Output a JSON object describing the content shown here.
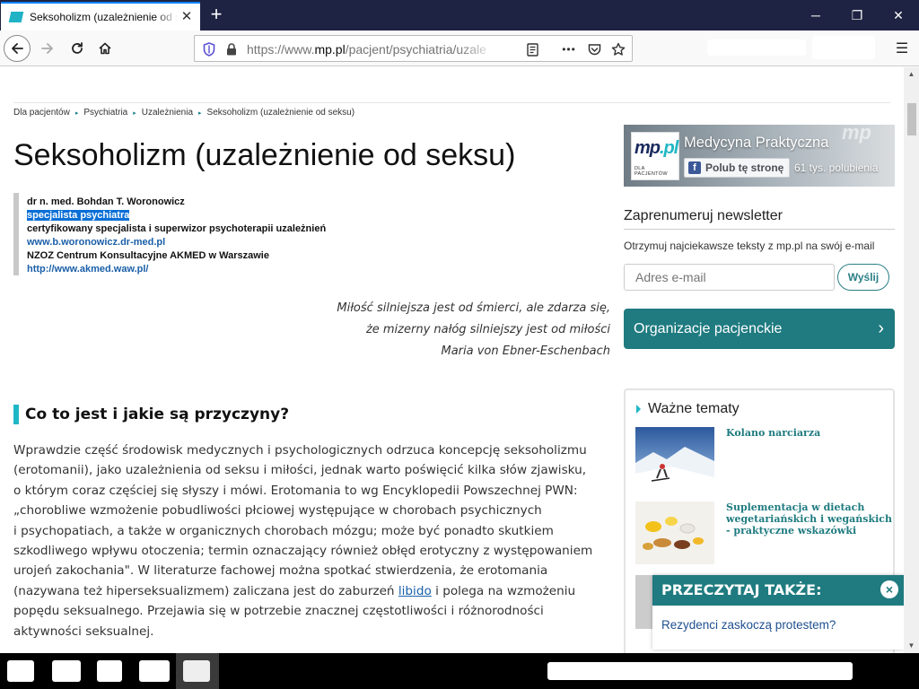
{
  "browser": {
    "tab_title": "Seksoholizm (uzależnienie od seksu)",
    "tab_close": "✕",
    "new_tab": "+",
    "url_prefix": "https://www.",
    "url_domain": "mp.pl",
    "url_path": "/pacjent/psychiatria/uzale",
    "window": {
      "minimize": "─",
      "restore": "❐",
      "close": "✕"
    },
    "more_actions": "•••",
    "menu": "☰"
  },
  "breadcrumb": [
    "Dla pacjentów",
    "Psychiatria",
    "Uzależnienia",
    "Seksoholizm (uzależnienie od seksu)"
  ],
  "breadcrumb_separator": "▸",
  "article": {
    "title": "Seksoholizm (uzależnienie od seksu)",
    "author": {
      "name": "dr n. med. Bohdan T. Woronowicz",
      "specialty": "specjalista psychiatra",
      "certification": "certyfikowany specjalista i superwizor psychoterapii uzależnień",
      "website": "www.b.woronowicz.dr-med.pl",
      "organization": "NZOZ Centrum Konsultacyjne AKMED w Warszawie",
      "org_url": "http://www.akmed.waw.pl/"
    },
    "quote": {
      "line1": "Miłość silniejsza jest od śmierci, ale zdarza się,",
      "line2": "że mizerny nałóg silniejszy jest od miłości",
      "author": "Maria von Ebner-Eschenbach"
    },
    "section_heading": "Co to jest i jakie są przyczyny?",
    "paragraph": {
      "l1": "Wprawdzie część środowisk medycznych i psychologicznych odrzuca koncepcję seksoholizmu",
      "l2": "(erotomanii), jako uzależnienia od seksu i miłości, jednak warto poświęcić kilka słów zjawisku,",
      "l3": "o którym coraz częściej się słyszy i mówi. Erotomania to wg Encyklopedii Powszechnej PWN:",
      "l4": "„chorobliwe wzmożenie pobudliwości płciowej występujące w chorobach psychicznych",
      "l5": "i psychopatiach, a także w organicznych chorobach mózgu; może być ponadto skutkiem",
      "l6": "szkodliwego wpływu otoczenia; termin oznaczający również obłęd erotyczny z występowaniem",
      "l7": "urojeń zakochania\". W literaturze fachowej można spotkać stwierdzenia, że erotomania",
      "l8_before": "(nazywana też hiperseksualizmem) zaliczana jest do zaburzeń ",
      "l8_link": "libido",
      "l8_after": " i polega na wzmożeniu",
      "l9": "popędu seksualnego. Przejawia się w potrzebie znacznej częstotliwości i różnorodności",
      "l10": "aktywności seksualnej."
    }
  },
  "sidebar": {
    "facebook": {
      "logo_mp": "mp",
      "logo_pl": ".pl",
      "logo_sub": "DLA PACJENTÓW",
      "page_name": "Medycyna Praktyczna",
      "like_label": "Polub tę stronę",
      "likes": "61 tys. polubienia",
      "brand": "mp"
    },
    "newsletter": {
      "title": "Zaprenumeruj newsletter",
      "description": "Otrzymuj najciekawsze teksty z mp.pl na swój e-mail",
      "placeholder": "Adres e-mail",
      "button": "Wyślij"
    },
    "organizations": {
      "label": "Organizacje pacjenckie",
      "chevron": "›"
    },
    "topics": {
      "title": "Ważne tematy",
      "items": [
        {
          "title": "Kolano narciarza"
        },
        {
          "title": "Suplementacja w dietach wegetariańskich i wegańskich - praktyczne wskazówki"
        }
      ]
    }
  },
  "popup": {
    "title": "PRZECZYTAJ TAKŻE:",
    "close": "×",
    "link": "Rezydenci zaskoczą protestem?"
  }
}
